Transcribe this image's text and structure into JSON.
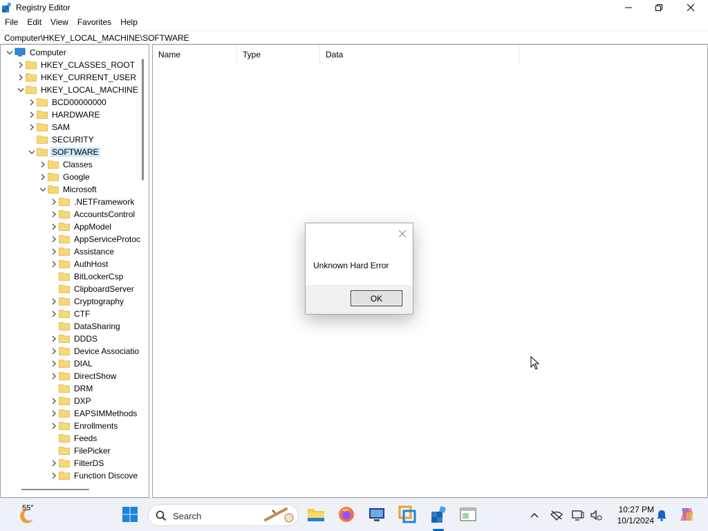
{
  "window": {
    "title": "Registry Editor"
  },
  "menu": [
    "File",
    "Edit",
    "View",
    "Favorites",
    "Help"
  ],
  "address": "Computer\\HKEY_LOCAL_MACHINE\\SOFTWARE",
  "tree": [
    {
      "label": "Computer",
      "depth": 0,
      "chevron": "down",
      "type": "computer"
    },
    {
      "label": "HKEY_CLASSES_ROOT",
      "depth": 1,
      "chevron": "right"
    },
    {
      "label": "HKEY_CURRENT_USER",
      "depth": 1,
      "chevron": "right"
    },
    {
      "label": "HKEY_LOCAL_MACHINE",
      "depth": 1,
      "chevron": "down"
    },
    {
      "label": "BCD00000000",
      "depth": 2,
      "chevron": "right"
    },
    {
      "label": "HARDWARE",
      "depth": 2,
      "chevron": "right"
    },
    {
      "label": "SAM",
      "depth": 2,
      "chevron": "right"
    },
    {
      "label": "SECURITY",
      "depth": 2,
      "chevron": "none"
    },
    {
      "label": "SOFTWARE",
      "depth": 2,
      "chevron": "down",
      "selected": true
    },
    {
      "label": "Classes",
      "depth": 3,
      "chevron": "right"
    },
    {
      "label": "Google",
      "depth": 3,
      "chevron": "right"
    },
    {
      "label": "Microsoft",
      "depth": 3,
      "chevron": "down"
    },
    {
      "label": ".NETFramework",
      "depth": 4,
      "chevron": "right"
    },
    {
      "label": "AccountsControl",
      "depth": 4,
      "chevron": "right"
    },
    {
      "label": "AppModel",
      "depth": 4,
      "chevron": "right"
    },
    {
      "label": "AppServiceProtoc",
      "depth": 4,
      "chevron": "right"
    },
    {
      "label": "Assistance",
      "depth": 4,
      "chevron": "right"
    },
    {
      "label": "AuthHost",
      "depth": 4,
      "chevron": "right"
    },
    {
      "label": "BitLockerCsp",
      "depth": 4,
      "chevron": "none"
    },
    {
      "label": "ClipboardServer",
      "depth": 4,
      "chevron": "none"
    },
    {
      "label": "Cryptography",
      "depth": 4,
      "chevron": "right"
    },
    {
      "label": "CTF",
      "depth": 4,
      "chevron": "right"
    },
    {
      "label": "DataSharing",
      "depth": 4,
      "chevron": "none"
    },
    {
      "label": "DDDS",
      "depth": 4,
      "chevron": "right"
    },
    {
      "label": "Device Associatio",
      "depth": 4,
      "chevron": "right"
    },
    {
      "label": "DIAL",
      "depth": 4,
      "chevron": "right"
    },
    {
      "label": "DirectShow",
      "depth": 4,
      "chevron": "right"
    },
    {
      "label": "DRM",
      "depth": 4,
      "chevron": "none"
    },
    {
      "label": "DXP",
      "depth": 4,
      "chevron": "right"
    },
    {
      "label": "EAPSIMMethods",
      "depth": 4,
      "chevron": "right"
    },
    {
      "label": "Enrollments",
      "depth": 4,
      "chevron": "right"
    },
    {
      "label": "Feeds",
      "depth": 4,
      "chevron": "none"
    },
    {
      "label": "FilePicker",
      "depth": 4,
      "chevron": "none"
    },
    {
      "label": "FilterDS",
      "depth": 4,
      "chevron": "right"
    },
    {
      "label": "Function Discove",
      "depth": 4,
      "chevron": "right"
    }
  ],
  "columns": [
    "Name",
    "Type",
    "Data"
  ],
  "dialog": {
    "message": "Unknown Hard Error",
    "ok_label": "OK"
  },
  "taskbar": {
    "temperature": "55°",
    "search_label": "Search",
    "time": "10:27 PM",
    "date": "10/1/2024"
  },
  "colors": {
    "selection": "#cce8ff",
    "folder": "#f8d775",
    "accent": "#0067c0"
  }
}
